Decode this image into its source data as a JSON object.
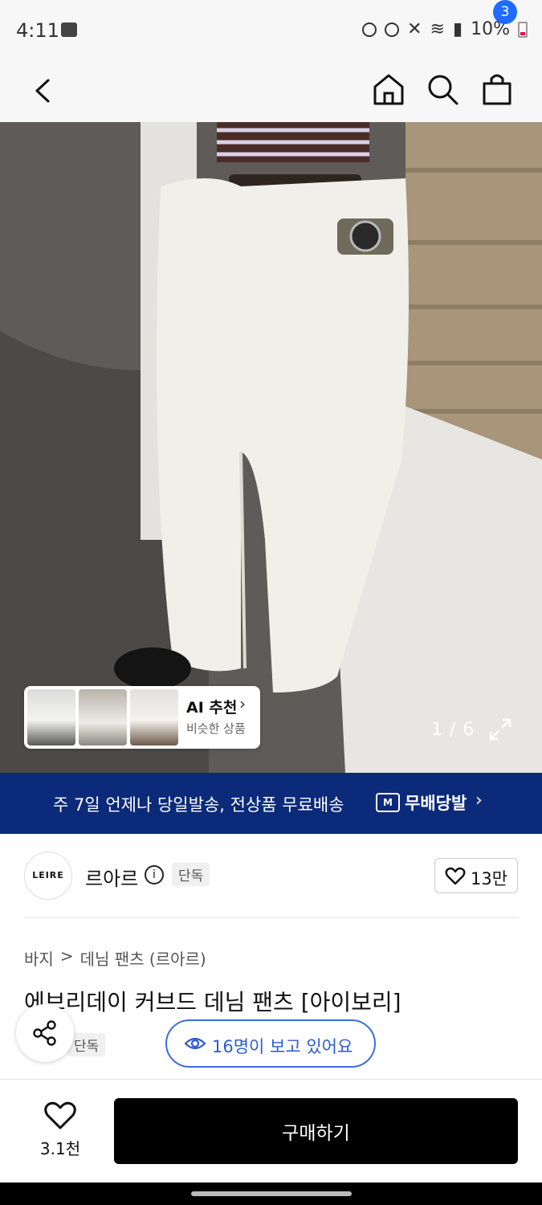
{
  "status_bar": {
    "time": "4:11",
    "battery": "10%"
  },
  "header": {
    "cart_count": "3"
  },
  "gallery": {
    "counter": "1 / 6",
    "ai": {
      "title": "AI 추천",
      "subtitle": "비슷한 상품"
    }
  },
  "banner": {
    "text": "주 7일 언제나 당일발송, 전상품 무료배송",
    "brand": "무배당발",
    "logo_letter": "M"
  },
  "brand": {
    "logo_text": "LEIRE",
    "name": "르아르",
    "info": "i",
    "tag": "단독",
    "likes": "13만"
  },
  "breadcrumb": {
    "category": "바지",
    "separator": ">",
    "subcategory": "데님 팬츠 (르아르)"
  },
  "product": {
    "title": "에브리데이 커브드 데님 팬츠 [아이보리]",
    "tag": "단독"
  },
  "viewers": {
    "text": "16명이 보고 있어요"
  },
  "bottom": {
    "wish_count": "3.1천",
    "buy_label": "구매하기"
  },
  "colors": {
    "accent": "#1f6bff",
    "banner": "#0b2a7a",
    "viewer_blue": "#2b5bd1"
  }
}
